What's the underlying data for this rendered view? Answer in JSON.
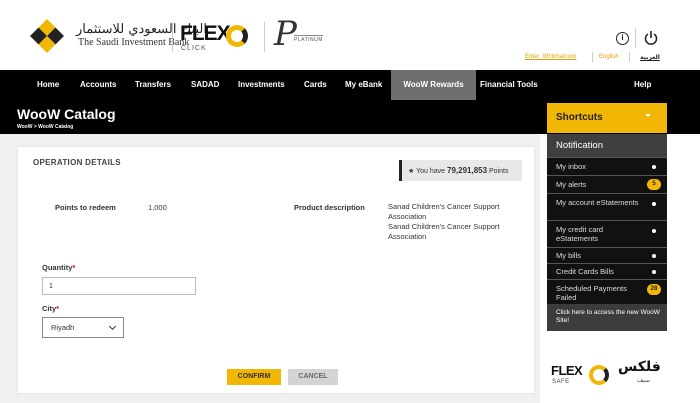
{
  "header": {
    "bank_name_ar": "البنك السعودي للاستثمار",
    "bank_name_en": "The Saudi Investment Bank",
    "flex_brand": "FLEX",
    "flex_sub": "CLICK",
    "platinum_text": "PLATINUM",
    "username_link": "Enter_Whitmarcom",
    "language_link": "English",
    "language_ar_link": "العربية",
    "info_icon": "info-icon",
    "power_icon": "power-icon"
  },
  "nav": {
    "items": [
      {
        "label": "Home"
      },
      {
        "label": "Accounts"
      },
      {
        "label": "Transfers"
      },
      {
        "label": "SADAD"
      },
      {
        "label": "Investments"
      },
      {
        "label": "Cards"
      },
      {
        "label": "My eBank"
      },
      {
        "label": "WooW Rewards",
        "active": true
      },
      {
        "label": "Financial Tools"
      },
      {
        "label": "Help"
      }
    ]
  },
  "page": {
    "title": "WooW Catalog",
    "breadcrumb": "WooW > WooW Catalog"
  },
  "operation": {
    "section_title": "OPERATION DETAILS",
    "points_prefix": "You have",
    "points_value": "79,291,853",
    "points_suffix": "Points",
    "points_label": "Points to redeem",
    "points_to_redeem": "1,000",
    "product_desc_label": "Product description",
    "product_desc_line1": "Sanad Children's Cancer Support Association",
    "product_desc_line2": "Sanad Children's Cancer Support Association",
    "quantity_label": "Quantity",
    "quantity_value": "1",
    "city_label": "City",
    "city_value": "Riyadh",
    "confirm_label": "CONFIRM",
    "cancel_label": "CANCEL",
    "required_mark": "*"
  },
  "shortcuts": {
    "title": "Shortcuts",
    "notification_title": "Notification",
    "items": [
      {
        "label": "My inbox",
        "badge": ""
      },
      {
        "label": "My alerts",
        "badge": "5"
      },
      {
        "label": "My account eStatements",
        "badge": ""
      },
      {
        "label": "My credit card eStatements",
        "badge": ""
      },
      {
        "label": "My bills",
        "badge": ""
      },
      {
        "label": "Credit Cards Bills",
        "badge": ""
      },
      {
        "label": "Scheduled Payments Failed",
        "badge": "28"
      }
    ],
    "woow_link": "Click here to access the new WooW Site!"
  },
  "flex_safe": {
    "brand": "FLEX",
    "sub": "SAFE",
    "brand_ar": "فلكس",
    "sub_ar": "سيف"
  },
  "colors": {
    "accent": "#f2b705",
    "nav_bg": "#000000",
    "active_nav": "#6f6f6f",
    "panel_bg": "#111111"
  }
}
